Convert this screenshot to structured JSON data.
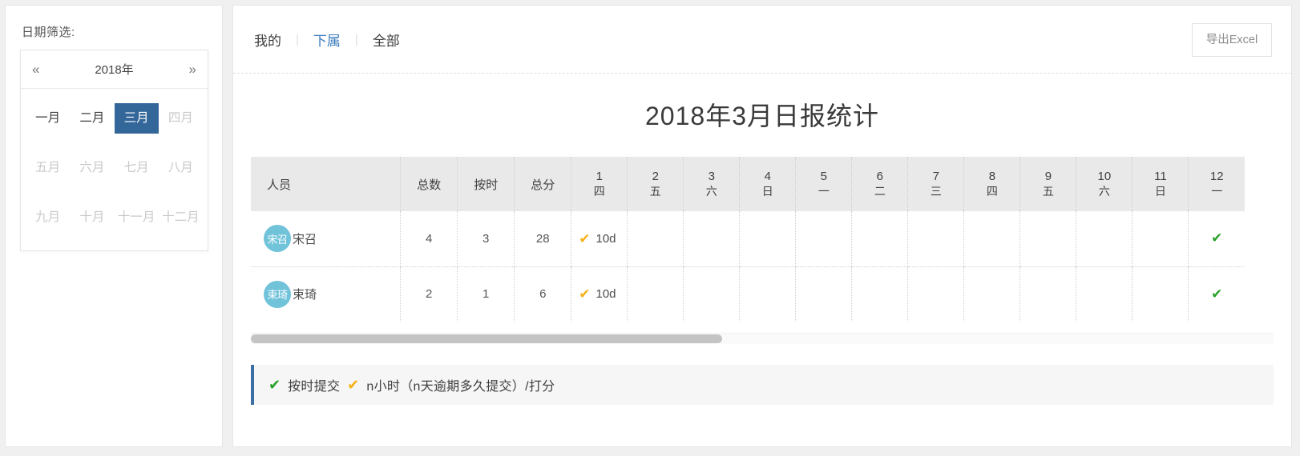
{
  "sidebar": {
    "filter_label": "日期筛选:",
    "datepicker": {
      "prev_icon": "«",
      "next_icon": "»",
      "year": "2018年",
      "months": [
        {
          "label": "一月",
          "state": "past"
        },
        {
          "label": "二月",
          "state": "past"
        },
        {
          "label": "三月",
          "state": "selected"
        },
        {
          "label": "四月",
          "state": "disabled"
        },
        {
          "label": "五月",
          "state": "disabled"
        },
        {
          "label": "六月",
          "state": "disabled"
        },
        {
          "label": "七月",
          "state": "disabled"
        },
        {
          "label": "八月",
          "state": "disabled"
        },
        {
          "label": "九月",
          "state": "disabled"
        },
        {
          "label": "十月",
          "state": "disabled"
        },
        {
          "label": "十一月",
          "state": "disabled"
        },
        {
          "label": "十二月",
          "state": "disabled"
        }
      ]
    }
  },
  "topbar": {
    "tabs": [
      {
        "label": "我的",
        "active": false
      },
      {
        "label": "下属",
        "active": true
      },
      {
        "label": "全部",
        "active": false
      }
    ],
    "separator": "|",
    "export_label": "导出Excel"
  },
  "report": {
    "title": "2018年3月日报统计"
  },
  "table": {
    "fixed_headers": [
      "人员",
      "总数",
      "按时",
      "总分"
    ],
    "day_headers": [
      {
        "day": "1",
        "weekday": "四"
      },
      {
        "day": "2",
        "weekday": "五"
      },
      {
        "day": "3",
        "weekday": "六"
      },
      {
        "day": "4",
        "weekday": "日"
      },
      {
        "day": "5",
        "weekday": "一"
      },
      {
        "day": "6",
        "weekday": "二"
      },
      {
        "day": "7",
        "weekday": "三"
      },
      {
        "day": "8",
        "weekday": "四"
      },
      {
        "day": "9",
        "weekday": "五"
      },
      {
        "day": "10",
        "weekday": "六"
      },
      {
        "day": "11",
        "weekday": "日"
      },
      {
        "day": "12",
        "weekday": "一"
      }
    ],
    "rows": [
      {
        "avatar_initials": "宋召",
        "name": "宋召",
        "total": "4",
        "on_time": "3",
        "score": "28",
        "days": [
          {
            "mark": "orange",
            "text": "10d"
          },
          {
            "mark": "",
            "text": ""
          },
          {
            "mark": "",
            "text": ""
          },
          {
            "mark": "",
            "text": ""
          },
          {
            "mark": "",
            "text": ""
          },
          {
            "mark": "",
            "text": ""
          },
          {
            "mark": "",
            "text": ""
          },
          {
            "mark": "",
            "text": ""
          },
          {
            "mark": "",
            "text": ""
          },
          {
            "mark": "",
            "text": ""
          },
          {
            "mark": "",
            "text": ""
          },
          {
            "mark": "green",
            "text": ""
          }
        ]
      },
      {
        "avatar_initials": "束琦",
        "name": "束琦",
        "total": "2",
        "on_time": "1",
        "score": "6",
        "days": [
          {
            "mark": "orange",
            "text": "10d"
          },
          {
            "mark": "",
            "text": ""
          },
          {
            "mark": "",
            "text": ""
          },
          {
            "mark": "",
            "text": ""
          },
          {
            "mark": "",
            "text": ""
          },
          {
            "mark": "",
            "text": ""
          },
          {
            "mark": "",
            "text": ""
          },
          {
            "mark": "",
            "text": ""
          },
          {
            "mark": "",
            "text": ""
          },
          {
            "mark": "",
            "text": ""
          },
          {
            "mark": "",
            "text": ""
          },
          {
            "mark": "green",
            "text": ""
          }
        ]
      }
    ]
  },
  "legend": {
    "ontime_mark": "✔",
    "ontime_text": "按时提交",
    "late_mark": "✔",
    "late_text": "n小时（n天逾期多久提交）/打分"
  },
  "colors": {
    "accent_blue": "#336699",
    "tab_active": "#3b7bbf",
    "avatar_bg": "#71c3da",
    "check_green": "#2aa02a",
    "check_orange": "#f5b117",
    "header_bg": "#e9e9e9"
  }
}
